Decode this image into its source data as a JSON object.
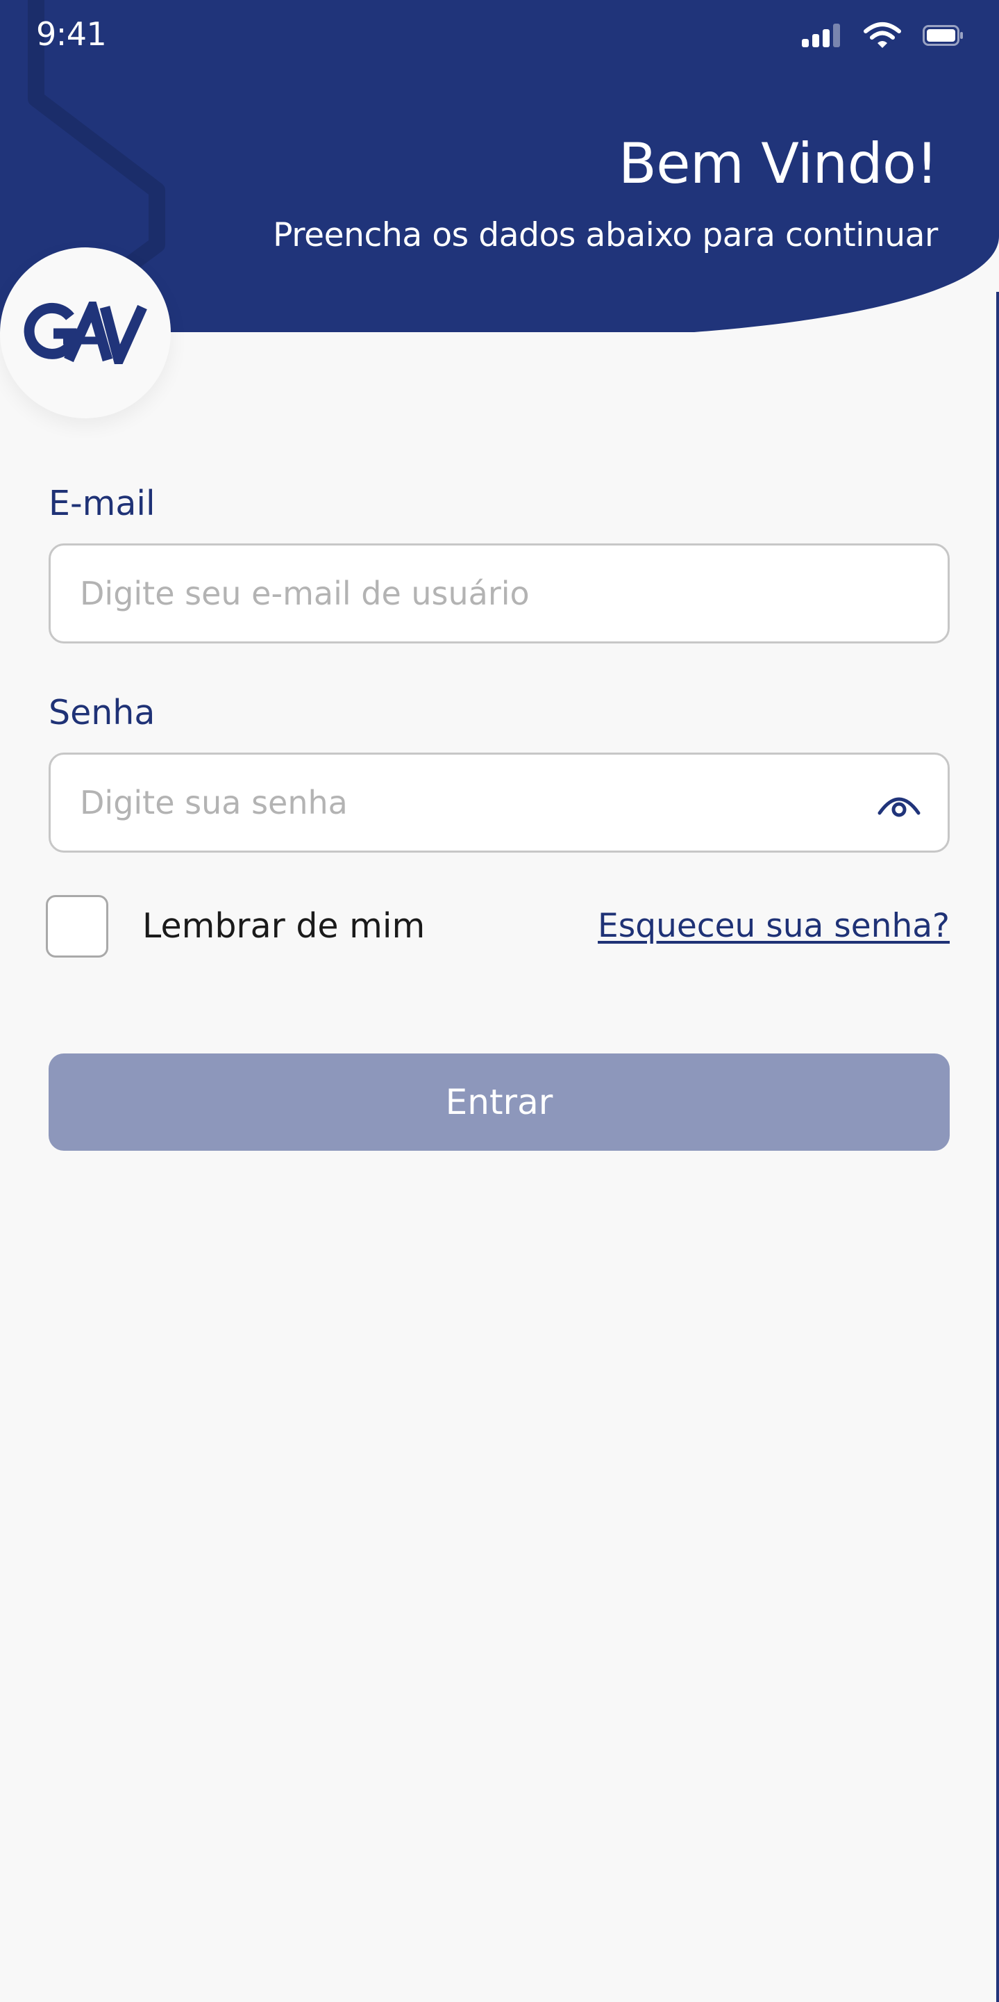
{
  "status_bar": {
    "time": "9:41",
    "signal_icon": "signal-bars-icon",
    "wifi_icon": "wifi-icon",
    "battery_icon": "battery-icon"
  },
  "header": {
    "title": "Bem Vindo!",
    "subtitle": "Preencha os dados abaixo para continuar",
    "logo_text": "GAV",
    "background_color": "#20347a"
  },
  "form": {
    "email": {
      "label": "E-mail",
      "value": "",
      "placeholder": "Digite seu e-mail de usuário"
    },
    "password": {
      "label": "Senha",
      "value": "",
      "placeholder": "Digite sua senha",
      "toggle_icon": "eye-icon"
    },
    "remember_me": {
      "label": "Lembrar de mim",
      "checked": false
    },
    "forgot_password_label": "Esqueceu sua senha?",
    "submit_label": "Entrar",
    "submit_color": "#8d97bb"
  },
  "colors": {
    "primary": "#20347a",
    "background": "#f8f8f8",
    "placeholder": "#b3b3b3",
    "input_border": "#c7c7c7"
  }
}
